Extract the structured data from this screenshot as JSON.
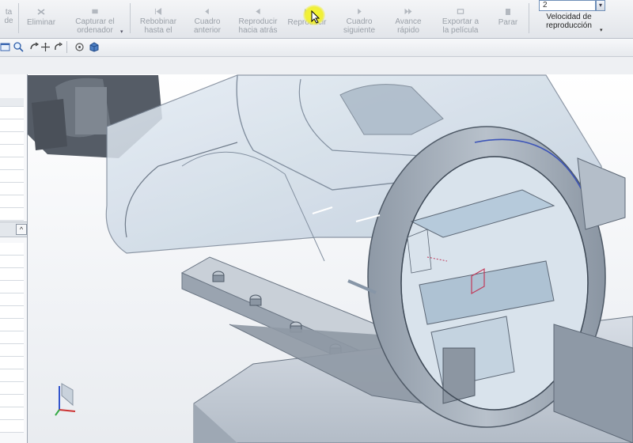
{
  "ribbon": {
    "partial_left_label": "ta\nde",
    "buttons": [
      {
        "label": "Eliminar",
        "icon": "delete-icon"
      },
      {
        "label": "Capturar el\nordenador",
        "icon": "capture-icon"
      },
      {
        "label": "Rebobinar\nhasta el",
        "icon": "rewind-icon"
      },
      {
        "label": "Cuadro\nanterior",
        "icon": "previous-frame-icon"
      },
      {
        "label": "Reproducir\nhacia atrás",
        "icon": "play-backward-icon"
      },
      {
        "label": "Reproducir",
        "icon": "play-icon"
      },
      {
        "label": "Cuadro\nsiguiente",
        "icon": "next-frame-icon"
      },
      {
        "label": "Avance\nrápido",
        "icon": "fast-forward-icon"
      },
      {
        "label": "Exportar a\nla película",
        "icon": "export-icon"
      },
      {
        "label": "Parar",
        "icon": "stop-icon"
      }
    ],
    "speed": {
      "value": "2",
      "label": "Velocidad de\nreproducción"
    }
  },
  "colors": {
    "ribbon_bg": "#e6e9ed",
    "cursor_highlight": "#f2f21a",
    "model_face": "#a7b3c1",
    "glass": "#c9d8e6",
    "triad_z": "#3355cc",
    "triad_x": "#cc3333"
  }
}
